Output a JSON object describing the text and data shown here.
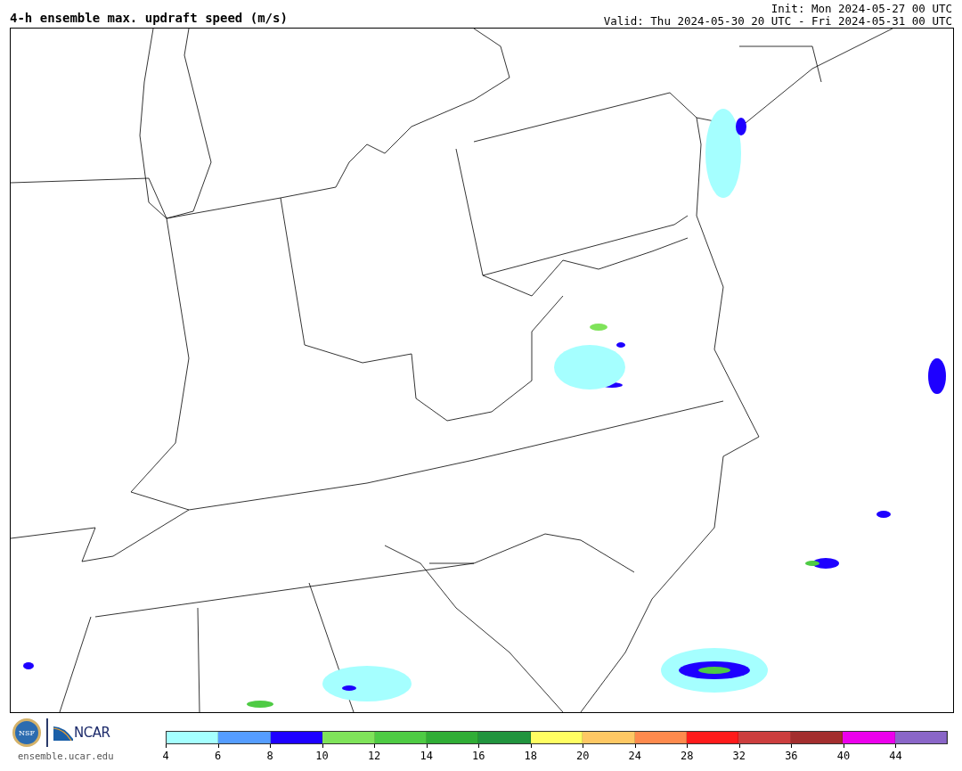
{
  "header": {
    "title": "4-h ensemble max. updraft speed (m/s)",
    "init": "Init: Mon 2024-05-27 00 UTC",
    "valid": "Valid: Thu 2024-05-30 20 UTC - Fri 2024-05-31 00 UTC"
  },
  "footer": {
    "seal_text": "NSF",
    "logo_text": "NCAR",
    "url": "ensemble.ucar.edu"
  },
  "colorbar": [
    {
      "label": "4",
      "color": "#a5ffff"
    },
    {
      "label": "6",
      "color": "#559dff"
    },
    {
      "label": "8",
      "color": "#1e00ff"
    },
    {
      "label": "10",
      "color": "#7fe35a"
    },
    {
      "label": "12",
      "color": "#4ecb44"
    },
    {
      "label": "14",
      "color": "#30ad36"
    },
    {
      "label": "16",
      "color": "#21943e"
    },
    {
      "label": "18",
      "color": "#fffe62"
    },
    {
      "label": "20",
      "color": "#fec864"
    },
    {
      "label": "24",
      "color": "#fe8a4d"
    },
    {
      "label": "28",
      "color": "#fe1b1b"
    },
    {
      "label": "32",
      "color": "#cc3e3e"
    },
    {
      "label": "36",
      "color": "#a32e2e"
    },
    {
      "label": "40",
      "color": "#ec00ec"
    },
    {
      "label": "44",
      "color": "#8a66c8"
    }
  ]
}
